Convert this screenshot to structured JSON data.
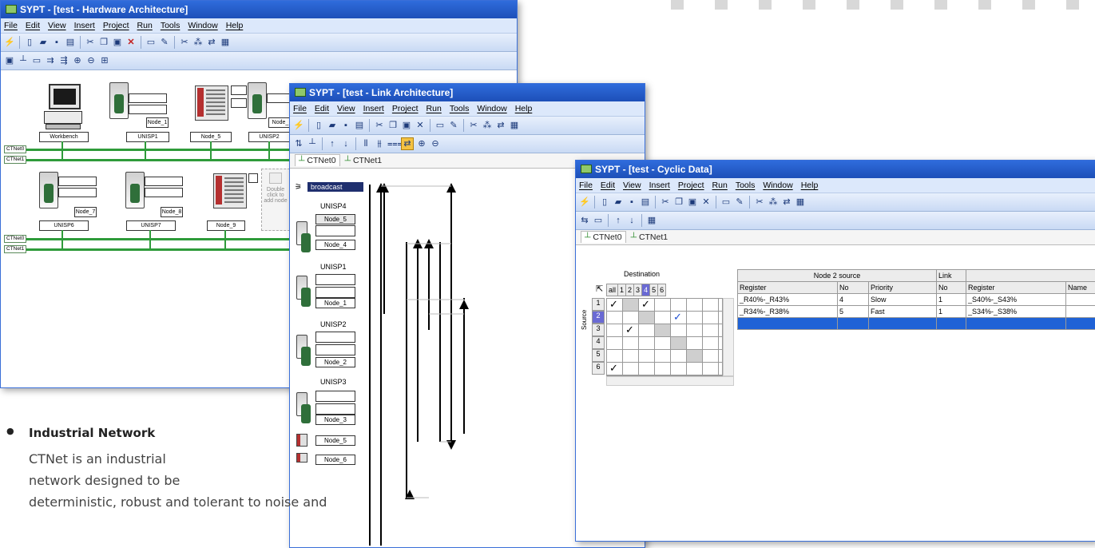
{
  "windows": {
    "hardware": {
      "title": "SYPT - [test - Hardware Architecture]",
      "menu": [
        "File",
        "Edit",
        "View",
        "Insert",
        "Project",
        "Run",
        "Tools",
        "Window",
        "Help"
      ],
      "nodes_row1": [
        "Workbench",
        "UNISP1",
        "Node_5",
        "UNISP2",
        "Node_"
      ],
      "node1_label": "Node_1",
      "nodes_row2": [
        "UNISP6",
        "UNISP7",
        "Node_9"
      ],
      "node7_label": "Node_7",
      "node8_label": "Node_8",
      "nets": [
        "CTNet0",
        "CTNet1"
      ],
      "hint_text": "Double click to add node"
    },
    "link": {
      "title": "SYPT - [test - Link Architecture]",
      "menu": [
        "File",
        "Edit",
        "View",
        "Insert",
        "Project",
        "Run",
        "Tools",
        "Window",
        "Help"
      ],
      "tabs": [
        "CTNet0",
        "CTNet1"
      ],
      "broadcast": "broadcast",
      "groups": [
        {
          "name": "UNISP4",
          "node": "Node_5",
          "extra": "Node_4"
        },
        {
          "name": "UNISP1",
          "node": "Node_1"
        },
        {
          "name": "UNISP2",
          "node": "Node_2"
        },
        {
          "name": "UNISP3",
          "node": "Node_3"
        }
      ],
      "tail_nodes": [
        "Node_5",
        "Node_6"
      ]
    },
    "cyclic": {
      "title": "SYPT - [test - Cyclic Data]",
      "menu": [
        "File",
        "Edit",
        "View",
        "Insert",
        "Project",
        "Run",
        "Tools",
        "Window",
        "Help"
      ],
      "tabs": [
        "CTNet0",
        "CTNet1"
      ],
      "destination_label": "Destination",
      "source_label": "Source",
      "matrix_cols": [
        "all",
        "1",
        "2",
        "3",
        "4",
        "5",
        "6"
      ],
      "matrix_rows": [
        "1",
        "2",
        "3",
        "4",
        "5",
        "6"
      ],
      "node_source_header": "Node 2 source",
      "link_header": "Link",
      "columns": [
        "Register",
        "No",
        "Priority",
        "No",
        "Register",
        "Name"
      ],
      "rows": [
        {
          "register": "_R40%-_R43%",
          "no": "4",
          "priority": "Slow",
          "link_no": "1",
          "dest_register": "_S40%-_S43%"
        },
        {
          "register": "_R34%-_R38%",
          "no": "5",
          "priority": "Fast",
          "link_no": "1",
          "dest_register": "_S34%-_S38%"
        }
      ]
    }
  },
  "feature": {
    "title": "Industrial Network",
    "lines": [
      "CTNet is an industrial",
      "network designed to be",
      "deterministic, robust and tolerant to noise and"
    ]
  },
  "colors": {
    "title_bar": "#2f6cdc",
    "net_line": "#2e9b3a",
    "highlight": "#1f62d6"
  }
}
